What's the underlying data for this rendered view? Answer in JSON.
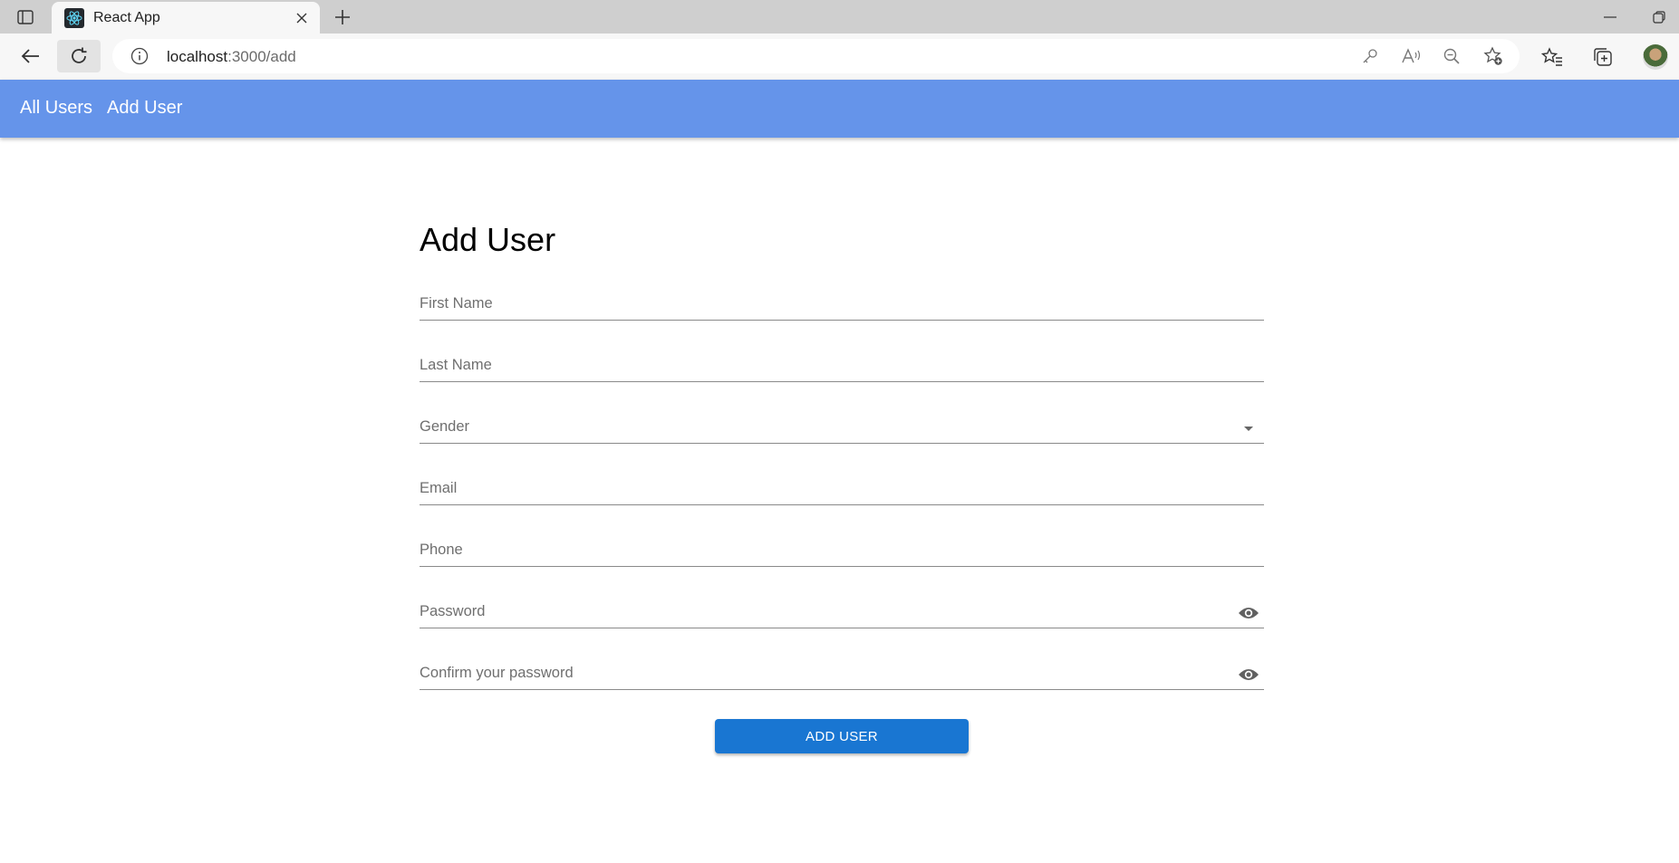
{
  "browser": {
    "tab_title": "React App",
    "url_host": "localhost",
    "url_path": ":3000/add"
  },
  "nav": {
    "all_users": "All Users",
    "add_user": "Add User"
  },
  "form": {
    "title": "Add User",
    "fields": {
      "first_name": "First Name",
      "last_name": "Last Name",
      "gender": "Gender",
      "email": "Email",
      "phone": "Phone",
      "password": "Password",
      "confirm_password": "Confirm your password"
    },
    "submit_label": "ADD USER"
  },
  "colors": {
    "appbar": "#6594ea",
    "button": "#1976d2"
  },
  "icons": {
    "password_toggle": "eye-icon",
    "select": "caret-down-icon"
  }
}
